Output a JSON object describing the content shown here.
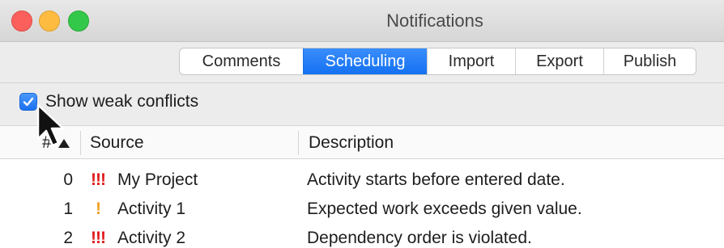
{
  "window": {
    "title": "Notifications"
  },
  "tabs": [
    {
      "label": "Comments",
      "active": false
    },
    {
      "label": "Scheduling",
      "active": true
    },
    {
      "label": "Import",
      "active": false
    },
    {
      "label": "Export",
      "active": false
    },
    {
      "label": "Publish",
      "active": false
    }
  ],
  "options": {
    "show_weak_conflicts_label": "Show weak conflicts",
    "show_weak_conflicts_checked": true
  },
  "table": {
    "headers": {
      "number": "#",
      "source": "Source",
      "description": "Description"
    },
    "sort": {
      "column": "number",
      "direction": "ascending"
    },
    "rows": [
      {
        "number": "0",
        "priority": "!!!",
        "source": "My Project",
        "description": "Activity starts before entered date."
      },
      {
        "number": "1",
        "priority": "!",
        "source": "Activity 1",
        "description": "Expected work exceeds given value."
      },
      {
        "number": "2",
        "priority": "!!!",
        "source": "Activity 2",
        "description": "Dependency order is violated."
      }
    ]
  },
  "colors": {
    "accent": "#1a72f0",
    "priority_high": "#e01b1b",
    "priority_medium": "#f0a020",
    "close": "#fc605c",
    "minimize": "#fdbc40",
    "maximize": "#34c84a"
  },
  "icons": {
    "close": "close-icon",
    "minimize": "minimize-icon",
    "maximize": "maximize-icon",
    "sort": "sort-ascending-icon",
    "cursor": "mouse-pointer-icon",
    "check": "checkmark-icon"
  }
}
